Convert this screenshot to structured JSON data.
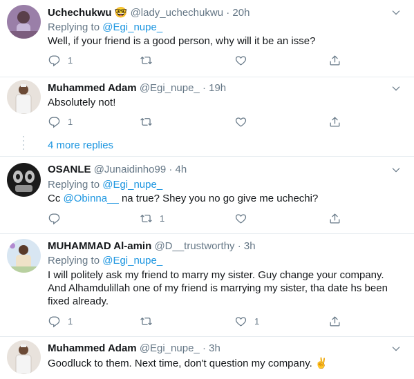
{
  "tweets": [
    {
      "name": "Uchechukwu",
      "emoji": "🤓",
      "handle": "@lady_uchechukwu",
      "time": "· 20h",
      "replying_prefix": "Replying to",
      "replying_to": "@Egi_nupe_",
      "text": "Well,  if your friend is a good person,  why will it be an isse?",
      "reply_count": "1",
      "retweet_count": "",
      "like_count": ""
    },
    {
      "name": "Muhammed Adam",
      "handle": "@Egi_nupe_",
      "time": "· 19h",
      "text": "Absolutely not!",
      "reply_count": "1",
      "retweet_count": "",
      "like_count": ""
    },
    {
      "name": "OSANLE",
      "handle": "@Junaidinho99",
      "time": "· 4h",
      "replying_prefix": "Replying to",
      "replying_to": "@Egi_nupe_",
      "text_prefix": "Cc ",
      "mention": "@Obinna__",
      "text_suffix": " na true? Shey you no go give me uchechi?",
      "reply_count": "",
      "retweet_count": "1",
      "like_count": ""
    },
    {
      "name": "MUHAMMAD Al-amin",
      "handle": "@D__trustworthy",
      "time": "· 3h",
      "replying_prefix": "Replying to",
      "replying_to": "@Egi_nupe_",
      "text": "I will politely ask my friend to marry my sister. Guy change your company. And Alhamdulillah one of my friend is marrying my sister, tha date hs been fixed already.",
      "reply_count": "1",
      "retweet_count": "",
      "like_count": "1"
    },
    {
      "name": "Muhammed Adam",
      "handle": "@Egi_nupe_",
      "time": "· 3h",
      "text": "Goodluck to them. Next time, don't question my company. ✌️"
    }
  ],
  "more_replies": "4 more replies",
  "icons": [
    "reply-icon",
    "retweet-icon",
    "like-icon",
    "share-icon",
    "chevron-down-icon"
  ],
  "colors": {
    "link": "#1b95e0",
    "muted": "#657786",
    "border": "#e6ecf0"
  }
}
